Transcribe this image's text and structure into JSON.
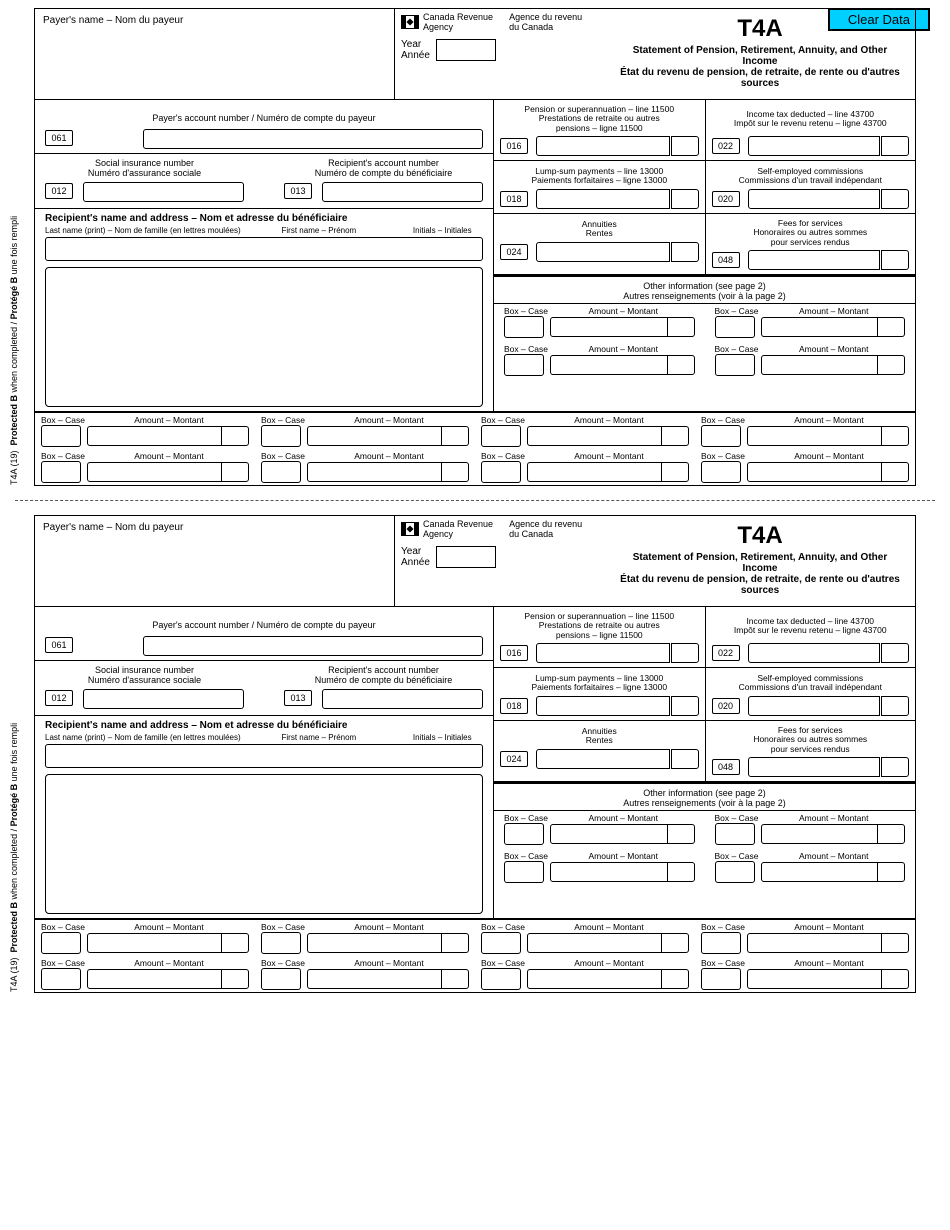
{
  "ui": {
    "clear_data": "Clear Data"
  },
  "form": {
    "payer_name_label": "Payer's name – Nom du payeur",
    "cra_en": "Canada Revenue",
    "cra_en2": "Agency",
    "cra_fr": "Agence du revenu",
    "cra_fr2": "du Canada",
    "year_en": "Year",
    "year_fr": "Année",
    "title": "T4A",
    "subtitle_en": "Statement of Pension, Retirement, Annuity, and Other Income",
    "subtitle_fr": "État du revenu de pension, de retraite, de rente ou d'autres sources",
    "acct_num_box": "061",
    "acct_num_label": "Payer's account number / Numéro de compte du payeur",
    "sin_label_en": "Social insurance number",
    "sin_label_fr": "Numéro d'assurance sociale",
    "sin_box": "012",
    "recip_acct_label_en": "Recipient's account number",
    "recip_acct_label_fr": "Numéro de compte du bénéficiaire",
    "recip_acct_box": "013",
    "recip_hdr": "Recipient's name and address – Nom et adresse du bénéficiaire",
    "last_name": "Last name (print)  –  Nom de famille (en lettres moulées)",
    "first_name": "First name – Prénom",
    "initials": "Initials – Initiales",
    "protected": "T4A (19)  Protected B when completed / Protégé B une fois rempli",
    "box_case": "Box – Case",
    "amount_montant": "Amount – Montant",
    "other_info_en": "Other information (see page 2)",
    "other_info_fr": "Autres renseignements (voir à la page 2)",
    "boxes": {
      "016": {
        "num": "016",
        "label": "Pension or superannuation – line 11500\nPrestations de retraite ou autres\npensions – ligne 11500"
      },
      "022": {
        "num": "022",
        "label": "Income tax deducted – line 43700\nImpôt sur le revenu retenu – ligne 43700"
      },
      "018": {
        "num": "018",
        "label": "Lump-sum payments – line 13000\nPaiements forfaitaires – ligne 13000"
      },
      "020": {
        "num": "020",
        "label": "Self-employed commissions\nCommissions d'un travail indépendant"
      },
      "024": {
        "num": "024",
        "label": "Annuities\nRentes"
      },
      "048": {
        "num": "048",
        "label": "Fees for services\nHonoraires ou autres sommes\npour services rendus"
      }
    }
  }
}
